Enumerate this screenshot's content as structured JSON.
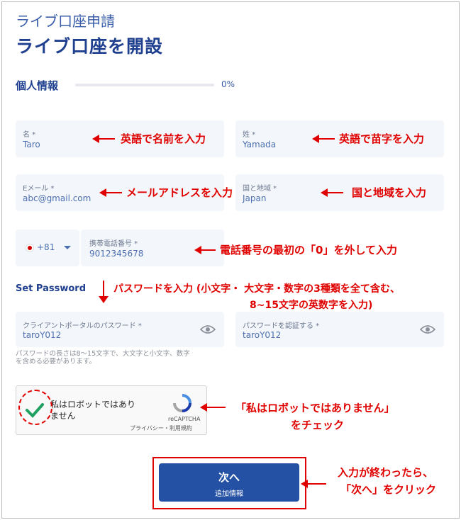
{
  "header": {
    "subtitle": "ライブ口座申請",
    "title": "ライブ口座を開設"
  },
  "section": {
    "label": "個人情報",
    "progress_text": "0%",
    "progress": 0
  },
  "fields": {
    "first_name": {
      "label": "名 *",
      "value": "Taro"
    },
    "last_name": {
      "label": "姓 *",
      "value": "Yamada"
    },
    "email": {
      "label": "Eメール *",
      "value": "abc@gmail.com"
    },
    "country": {
      "label": "国と地域 *",
      "value": "Japan"
    },
    "phone_code": {
      "value": "+81"
    },
    "phone": {
      "label": "携帯電話番号 *",
      "value": "9012345678"
    },
    "password": {
      "label": "クライアントポータルのパスワード *",
      "value": "taroY012"
    },
    "password_confirm": {
      "label": "パスワードを認証する *",
      "value": "taroY012"
    }
  },
  "set_password_label": "Set Password",
  "password_help": [
    "パスワードの長さは8〜15文字で、大文字と小文字、数字",
    "を含める必要があります。"
  ],
  "captcha": {
    "text_line1": "私はロボットではあり",
    "text_line2": "ません",
    "brand": "reCAPTCHA",
    "links": "プライバシー・利用規約"
  },
  "next_button": {
    "label": "次へ",
    "sublabel": "追加情報"
  },
  "annotations": {
    "first_name": "英語で名前を入力",
    "last_name": "英語で苗字を入力",
    "email": "メールアドレスを入力",
    "country": "国と地域を入力",
    "phone": "電話番号の最初の「0」を外して入力",
    "password_line1": "パスワードを入力 (小文字・ 大文字・数字の3種類を全て含む、",
    "password_line2": "8~15文字の英数字を入力)",
    "captcha_line1": "「私はロボットではありません」",
    "captcha_line2": "をチェック",
    "next_line1": "入力が終わったら、",
    "next_line2": "「次へ」をクリック"
  },
  "colors": {
    "accent": "#1f3f8f",
    "button": "#2451a4",
    "annotation": "#e00000",
    "field_bg": "#f3f6fa"
  }
}
